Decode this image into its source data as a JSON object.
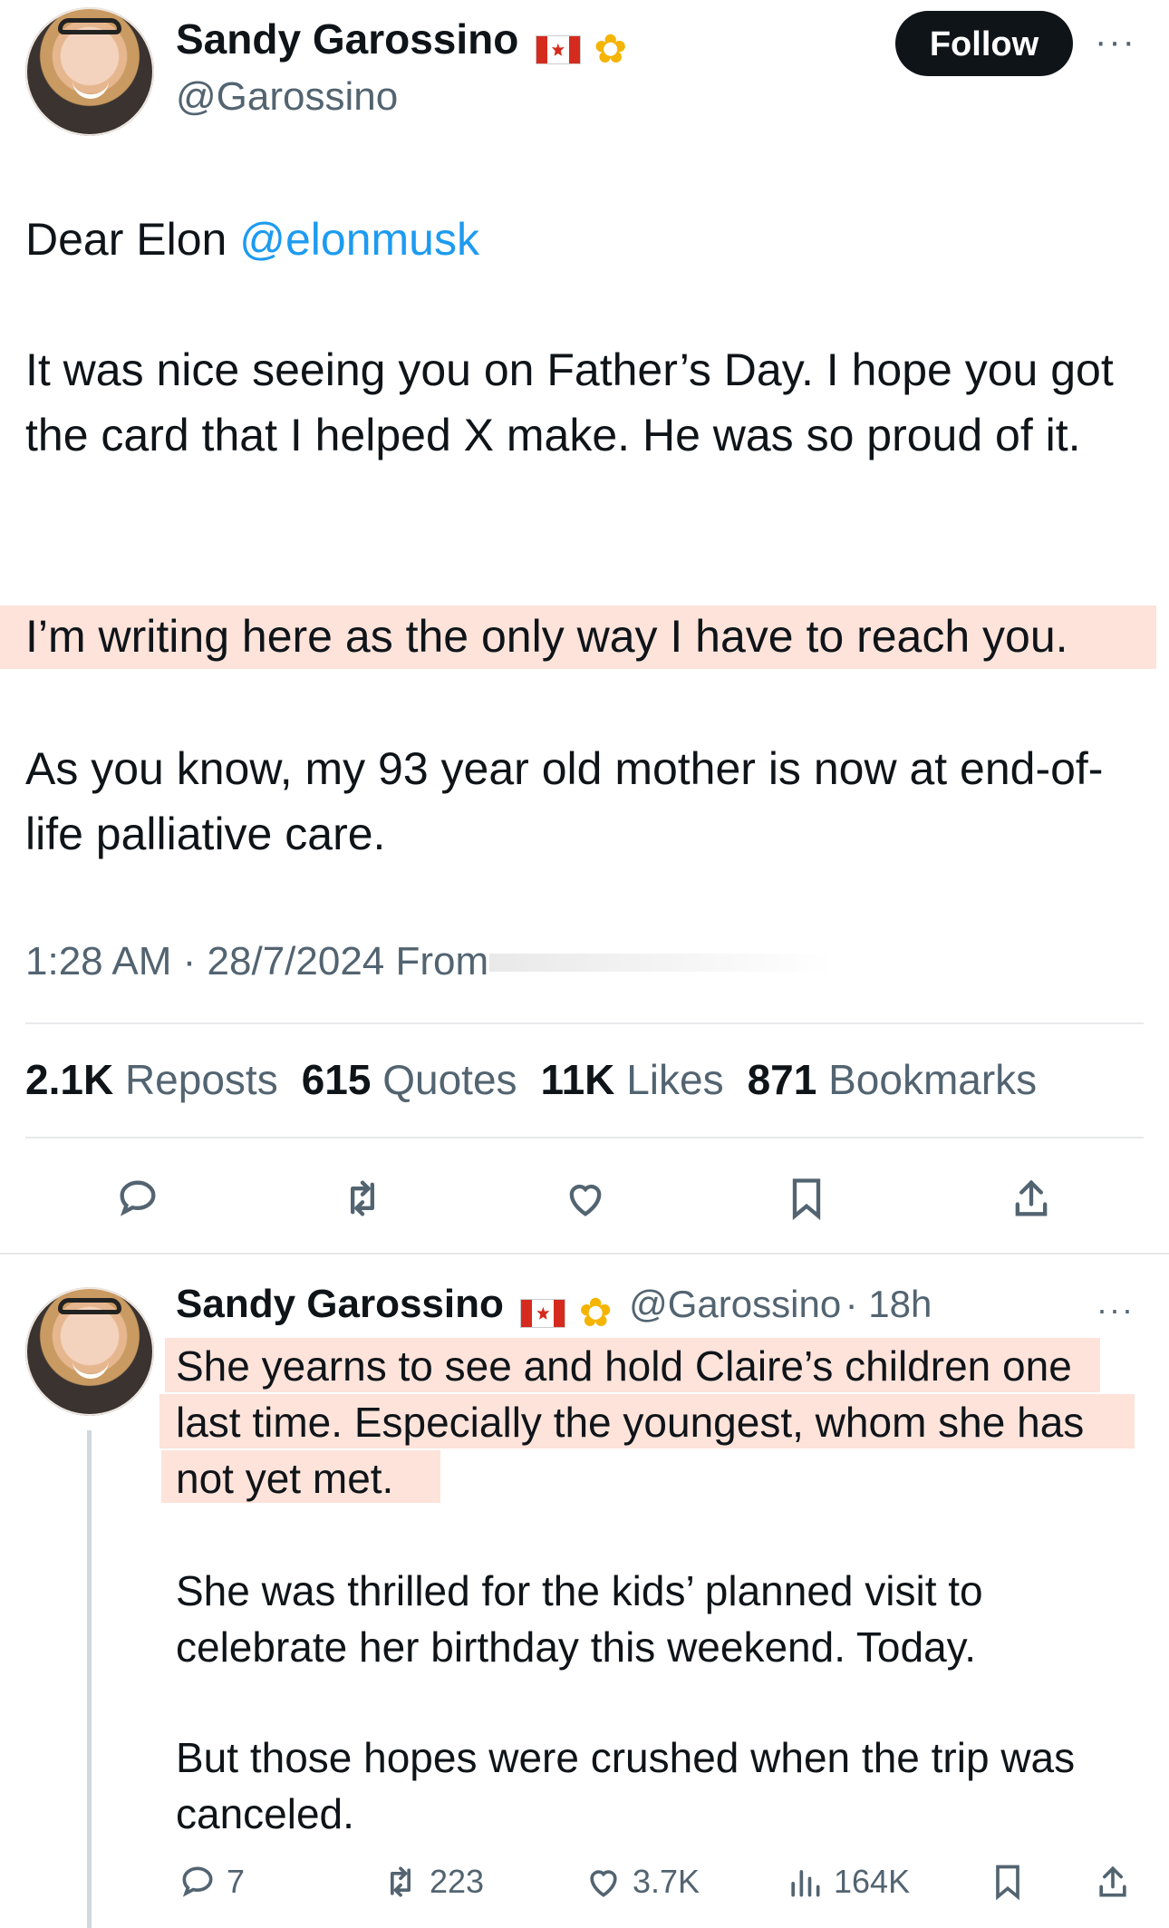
{
  "tweet": {
    "author_name": "Sandy Garossino",
    "author_handle": "@Garossino",
    "follow_label": "Follow",
    "more_label": "···",
    "greeting_text": "Dear Elon ",
    "mention": "@elonmusk",
    "paragraph_1": "It was nice seeing you on Father’s Day. I hope you got the card that I helped X make. He was so proud of it.",
    "paragraph_2": "I’m writing here as the only way I have to reach you.",
    "paragraph_3": "As you know, my 93 year old mother is now at end-of-life palliative care.",
    "timestamp": "1:28 AM · 28/7/2024 From",
    "stats": [
      {
        "value": "2.1K",
        "label": "Reposts"
      },
      {
        "value": "615",
        "label": "Quotes"
      },
      {
        "value": "11K",
        "label": "Likes"
      },
      {
        "value": "871",
        "label": "Bookmarks"
      }
    ],
    "icons": [
      "reply-icon",
      "repost-icon",
      "like-icon",
      "bookmark-icon",
      "share-icon"
    ]
  },
  "reply": {
    "author_name": "Sandy Garossino",
    "author_handle": "@Garossino",
    "time": "· 18h",
    "more_label": "···",
    "paragraph_1": "She yearns to see and hold Claire’s children one last time. Especially the youngest, whom she has not yet met.",
    "paragraph_2": "She was thrilled for the kids’ planned visit to celebrate her birthday this weekend. Today.",
    "paragraph_3": "But those hopes were crushed when the trip was canceled.",
    "actions": {
      "replies": "7",
      "reposts": "223",
      "likes": "3.7K",
      "views": "164K"
    }
  },
  "colors": {
    "highlight": "#fde3da",
    "mention": "#1d9bf0",
    "secondary_text": "#536471",
    "divider": "#e7e9ea"
  }
}
